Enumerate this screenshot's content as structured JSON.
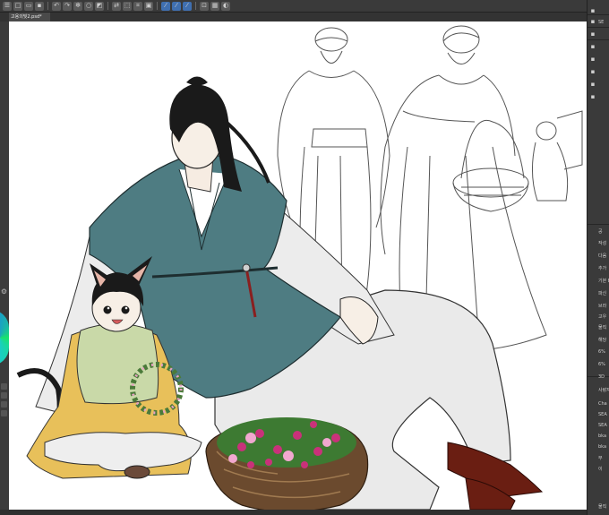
{
  "app": {
    "document_tab": "고용의빚2.psd*"
  },
  "toolbar": {
    "buttons": [
      {
        "icon": "menu-icon",
        "glyph": "☰"
      },
      {
        "icon": "new-file-icon",
        "glyph": "□"
      },
      {
        "icon": "open-folder-icon",
        "glyph": "▭"
      },
      {
        "icon": "save-icon",
        "glyph": "▪"
      },
      {
        "icon": "undo-icon",
        "glyph": "↶"
      },
      {
        "icon": "redo-icon",
        "glyph": "↷"
      },
      {
        "icon": "spinner-icon",
        "glyph": "✻"
      },
      {
        "icon": "clear-icon",
        "glyph": "○"
      },
      {
        "icon": "fill-icon",
        "glyph": "◩"
      },
      {
        "icon": "transform-icon",
        "glyph": "⇄"
      },
      {
        "icon": "selection-icon",
        "glyph": "⬚"
      },
      {
        "icon": "crop-icon",
        "glyph": "⌗"
      },
      {
        "icon": "convert-icon",
        "glyph": "▣"
      },
      {
        "icon": "ruler-icon-1",
        "glyph": "⁄",
        "active": true
      },
      {
        "icon": "ruler-icon-2",
        "glyph": "⁄",
        "active": true
      },
      {
        "icon": "ruler-icon-3",
        "glyph": "⁄",
        "active": true
      },
      {
        "icon": "snap-icon",
        "glyph": "⊡"
      },
      {
        "icon": "grid-icon",
        "glyph": "▦"
      },
      {
        "icon": "color-icon",
        "glyph": "◐"
      }
    ]
  },
  "rightpanel": {
    "labels": [
      "SE",
      "공",
      "작성",
      "다움",
      "추가",
      "기본 B",
      "파신",
      "브라",
      "고우",
      "물직",
      "해당",
      "6%",
      "6%",
      "3D",
      "사랑자",
      "Cha",
      "SEA",
      "SEA",
      "bka",
      "bka",
      "부",
      "이",
      "물직"
    ]
  },
  "colors": {
    "accent": "#3f6fb0",
    "canvas_bg": "#ffffff",
    "hanbok_teal": "#4e7c82",
    "hanbok_green": "#c9d9a8",
    "hanbok_yellow": "#e8c05a",
    "basket_brown": "#6b4a2e",
    "shoe_red": "#6a1e12"
  }
}
